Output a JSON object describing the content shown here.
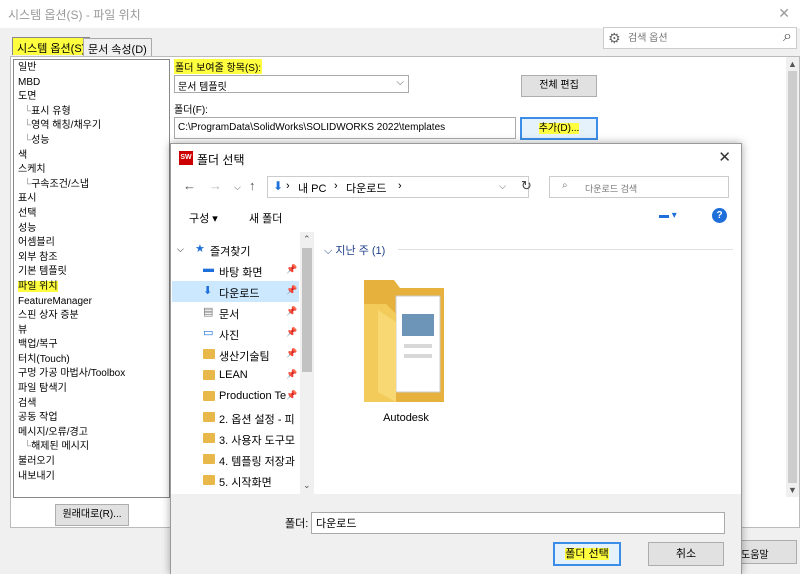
{
  "window": {
    "title": "시스템 옵션(S) - 파일 위치",
    "close_glyph": "✕"
  },
  "tabs": [
    {
      "label": "시스템 옵션(S)",
      "active": true
    },
    {
      "label": "문서 속성(D)",
      "active": false
    }
  ],
  "search": {
    "placeholder": "검색 옵션"
  },
  "tree": {
    "items": [
      {
        "label": "일반",
        "child": false
      },
      {
        "label": "MBD",
        "child": false
      },
      {
        "label": "도면",
        "child": false
      },
      {
        "label": "표시 유형",
        "child": true
      },
      {
        "label": "영역 해칭/채우기",
        "child": true
      },
      {
        "label": "성능",
        "child": true
      },
      {
        "label": "색",
        "child": false
      },
      {
        "label": "스케치",
        "child": false
      },
      {
        "label": "구속조건/스냅",
        "child": true
      },
      {
        "label": "표시",
        "child": false
      },
      {
        "label": "선택",
        "child": false
      },
      {
        "label": "성능",
        "child": false
      },
      {
        "label": "어셈블리",
        "child": false
      },
      {
        "label": "외부 참조",
        "child": false
      },
      {
        "label": "기본 템플릿",
        "child": false
      },
      {
        "label": "파일 위치",
        "child": false,
        "selected": true
      },
      {
        "label": "FeatureManager",
        "child": false
      },
      {
        "label": "스핀 상자 증분",
        "child": false
      },
      {
        "label": "뷰",
        "child": false
      },
      {
        "label": "백업/복구",
        "child": false
      },
      {
        "label": "터치(Touch)",
        "child": false
      },
      {
        "label": "구멍 가공 마법사/Toolbox",
        "child": false
      },
      {
        "label": "파일 탐색기",
        "child": false
      },
      {
        "label": "검색",
        "child": false
      },
      {
        "label": "공동 작업",
        "child": false
      },
      {
        "label": "메시지/오류/경고",
        "child": false
      },
      {
        "label": "해제된 메시지",
        "child": true
      },
      {
        "label": "불러오기",
        "child": false
      },
      {
        "label": "내보내기",
        "child": false
      }
    ]
  },
  "reset_button": "원래대로(R)...",
  "folder_settings": {
    "show_label": "폴더 보여줄 항목(S):",
    "show_value": "문서 템플릿",
    "edit_all_button": "전체 편집",
    "folders_label": "폴더(F):",
    "folder_path": "C:\\ProgramData\\SolidWorks\\SOLIDWORKS 2022\\templates",
    "add_button": "추가(D)..."
  },
  "help_button_partial": "도움말",
  "dialog": {
    "title": "폴더 선택",
    "app_icon_text": "SW",
    "close_glyph": "✕",
    "address": {
      "pc": "내 PC",
      "sep": "›",
      "folder": "다운로드"
    },
    "search_placeholder": "다운로드 검색",
    "toolbar": {
      "organize": "구성 ▾",
      "new_folder": "새 폴더",
      "help": "?"
    },
    "nav_items": [
      {
        "label": "즐겨찾기",
        "icon": "star-icon",
        "type": "header"
      },
      {
        "label": "바탕 화면",
        "icon": "desktop-icon",
        "pinned": true
      },
      {
        "label": "다운로드",
        "icon": "download-icon",
        "pinned": true,
        "selected": true
      },
      {
        "label": "문서",
        "icon": "document-icon",
        "pinned": true
      },
      {
        "label": "사진",
        "icon": "pictures-icon",
        "pinned": true
      },
      {
        "label": "생산기술팀",
        "icon": "folder-icon",
        "pinned": true
      },
      {
        "label": "LEAN",
        "icon": "folder-icon",
        "pinned": true
      },
      {
        "label": "Production Te",
        "icon": "folder-icon",
        "pinned": true
      },
      {
        "label": "2. 옵션 설정 - 피",
        "icon": "folder-icon"
      },
      {
        "label": "3. 사용자 도구모",
        "icon": "folder-icon"
      },
      {
        "label": "4. 템플링 저장과",
        "icon": "folder-icon"
      },
      {
        "label": "5. 시작화면",
        "icon": "folder-icon"
      }
    ],
    "group_header": "지난 주 (1)",
    "files": [
      {
        "name": "Autodesk",
        "icon": "folder-icon"
      }
    ],
    "folder_label": "폴더:",
    "folder_value": "다운로드",
    "select_button": "폴더 선택",
    "cancel_button": "취소"
  },
  "colors": {
    "highlight": "#ffff40",
    "accent": "#1e6fd9",
    "selection": "#cce8ff",
    "folder": "#e8b84a"
  }
}
